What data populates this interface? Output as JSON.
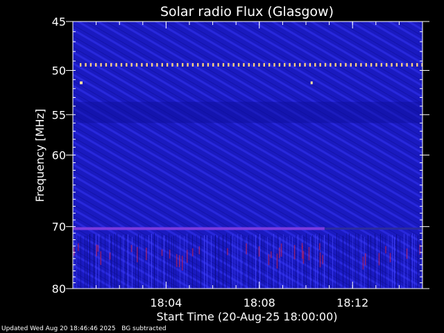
{
  "chart_data": {
    "type": "heatmap",
    "title": "Solar radio Flux (Glasgow)",
    "xlabel": "Start Time (20-Aug-25 18:00:00)",
    "ylabel": "Frequency [MHz]",
    "x_range_minutes": [
      0,
      15
    ],
    "x_ticks": [
      {
        "minute": 4,
        "label": "18:04"
      },
      {
        "minute": 8,
        "label": "18:08"
      },
      {
        "minute": 12,
        "label": "18:12"
      }
    ],
    "y_scale": "log",
    "y_range_mhz": [
      45,
      80
    ],
    "y_ticks": [
      {
        "value": 45,
        "label": "45"
      },
      {
        "value": 50,
        "label": "50"
      },
      {
        "value": 55,
        "label": "55"
      },
      {
        "value": 60,
        "label": "60"
      },
      {
        "value": 70,
        "label": "70"
      },
      {
        "value": 80,
        "label": "80"
      }
    ],
    "colormap": [
      "#00008b",
      "#1818c8",
      "#3838ff",
      "#7a1fd0",
      "#c02050",
      "#ff4000",
      "#ffc000",
      "#ffffff"
    ],
    "background_color": "#1a1ac0",
    "features": [
      {
        "name": "interference line",
        "freq_mhz": 49.4,
        "x_range_minutes": [
          0,
          15
        ],
        "intensity": "high"
      },
      {
        "name": "interference line",
        "freq_mhz": 70.3,
        "x_range_minutes": [
          0,
          10.8
        ],
        "intensity": "medium"
      }
    ],
    "grid": false,
    "legend": "none"
  },
  "footer": {
    "updated": "Updated Wed Aug 20 18:46:46 2025",
    "note": "BG subtracted"
  }
}
